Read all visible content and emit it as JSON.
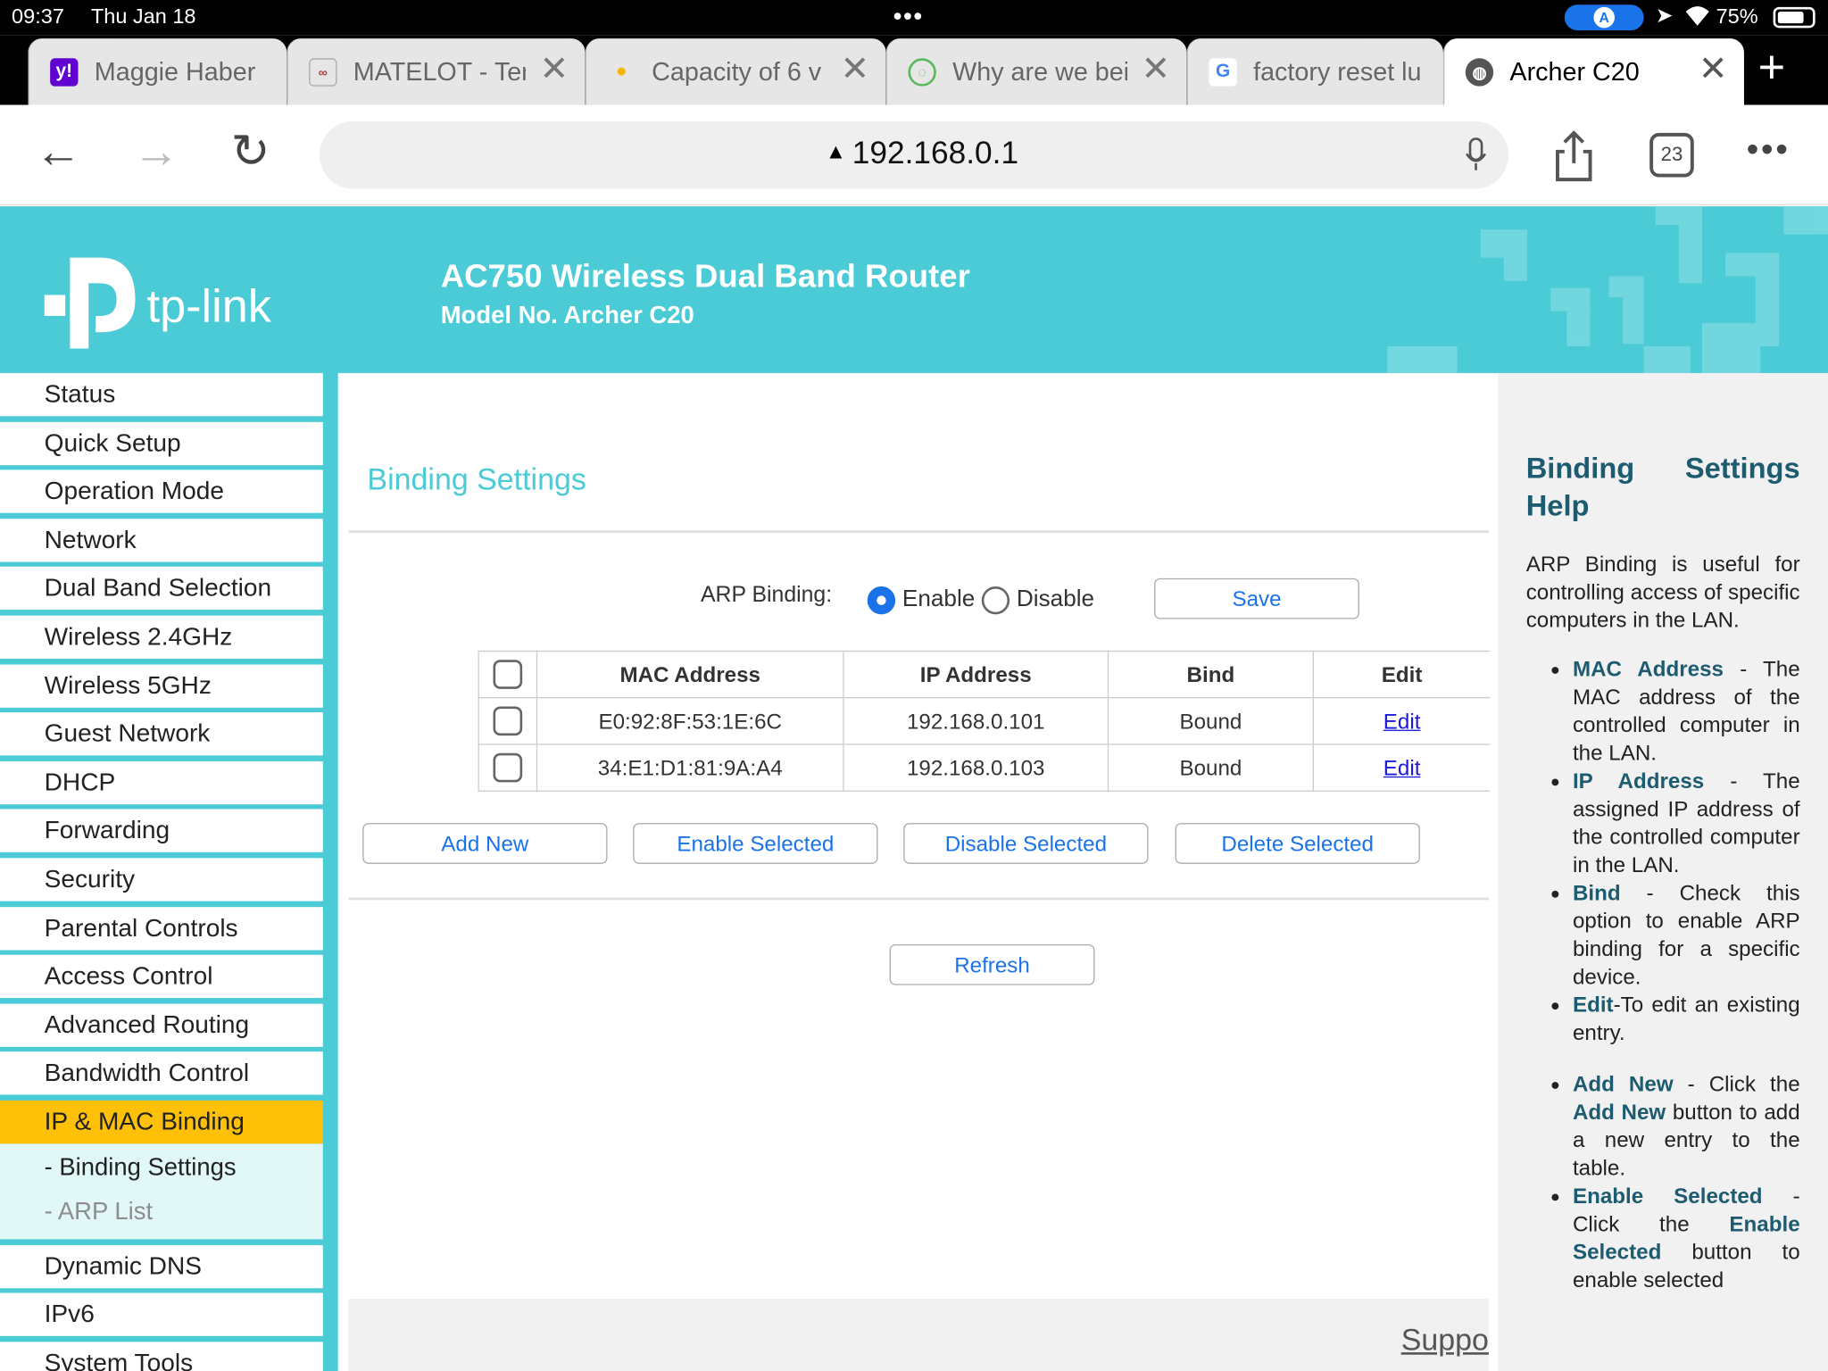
{
  "status_bar": {
    "time": "09:37",
    "date": "Thu Jan 18",
    "battery": "75%"
  },
  "tabs": [
    {
      "title": "Maggie Haber",
      "favicon": "yahoo-icon"
    },
    {
      "title": "MATELOT - Ter",
      "favicon": "matelot-icon"
    },
    {
      "title": "Capacity of 6 v",
      "favicon": "bulb-icon"
    },
    {
      "title": "Why are we bei",
      "favicon": "circle-logo-icon"
    },
    {
      "title": "factory reset lu",
      "favicon": "google-icon"
    },
    {
      "title": "Archer C20",
      "favicon": "globe-icon"
    }
  ],
  "browser": {
    "url": "192.168.0.1",
    "tab_count": "23"
  },
  "router": {
    "brand": "tp-link",
    "title": "AC750 Wireless Dual Band Router",
    "model": "Model No. Archer C20"
  },
  "sidebar": {
    "items": [
      "Status",
      "Quick Setup",
      "Operation Mode",
      "Network",
      "Dual Band Selection",
      "Wireless 2.4GHz",
      "Wireless 5GHz",
      "Guest Network",
      "DHCP",
      "Forwarding",
      "Security",
      "Parental Controls",
      "Access Control",
      "Advanced Routing",
      "Bandwidth Control",
      "IP & MAC Binding"
    ],
    "submenu": [
      "- Binding Settings",
      "- ARP List"
    ],
    "items_after": [
      "Dynamic DNS",
      "IPv6",
      "System Tools"
    ]
  },
  "main": {
    "title": "Binding Settings",
    "arp_label": "ARP Binding:",
    "enable_label": "Enable",
    "disable_label": "Disable",
    "save_label": "Save",
    "table": {
      "headers": [
        "MAC Address",
        "IP Address",
        "Bind",
        "Edit"
      ],
      "rows": [
        {
          "mac": "E0:92:8F:53:1E:6C",
          "ip": "192.168.0.101",
          "bind": "Bound",
          "edit": "Edit"
        },
        {
          "mac": "34:E1:D1:81:9A:A4",
          "ip": "192.168.0.103",
          "bind": "Bound",
          "edit": "Edit"
        }
      ]
    },
    "add_new": "Add New",
    "enable_selected": "Enable Selected",
    "disable_selected": "Disable Selected",
    "delete_selected": "Delete Selected",
    "refresh": "Refresh",
    "support": "Suppo"
  },
  "help": {
    "title_1": "Binding Settings",
    "title_2": "Help",
    "intro": "ARP Binding is useful for controlling access of specific computers in the LAN.",
    "items": [
      {
        "term": "MAC Address",
        "text": " - The MAC address of the controlled computer in the LAN."
      },
      {
        "term": "IP Address",
        "text": " - The assigned IP address of the controlled computer in the LAN."
      },
      {
        "term": "Bind",
        "text": " - Check this option to enable ARP binding for a specific device."
      },
      {
        "term": "Edit",
        "text": "-To edit an existing entry."
      }
    ],
    "items2": [
      {
        "term": "Add New",
        "text": " - Click the ",
        "term2": "Add New",
        "text2": " button to add a new entry to the table."
      },
      {
        "term": "Enable Selected",
        "text": " - Click the ",
        "term2": "Enable Selected",
        "text2": " button to enable selected"
      }
    ]
  },
  "colors": {
    "teal": "#4acbd6",
    "active_menu": "#ffc107",
    "link_blue": "#1a73e8",
    "help_heading": "#1d5b70"
  }
}
